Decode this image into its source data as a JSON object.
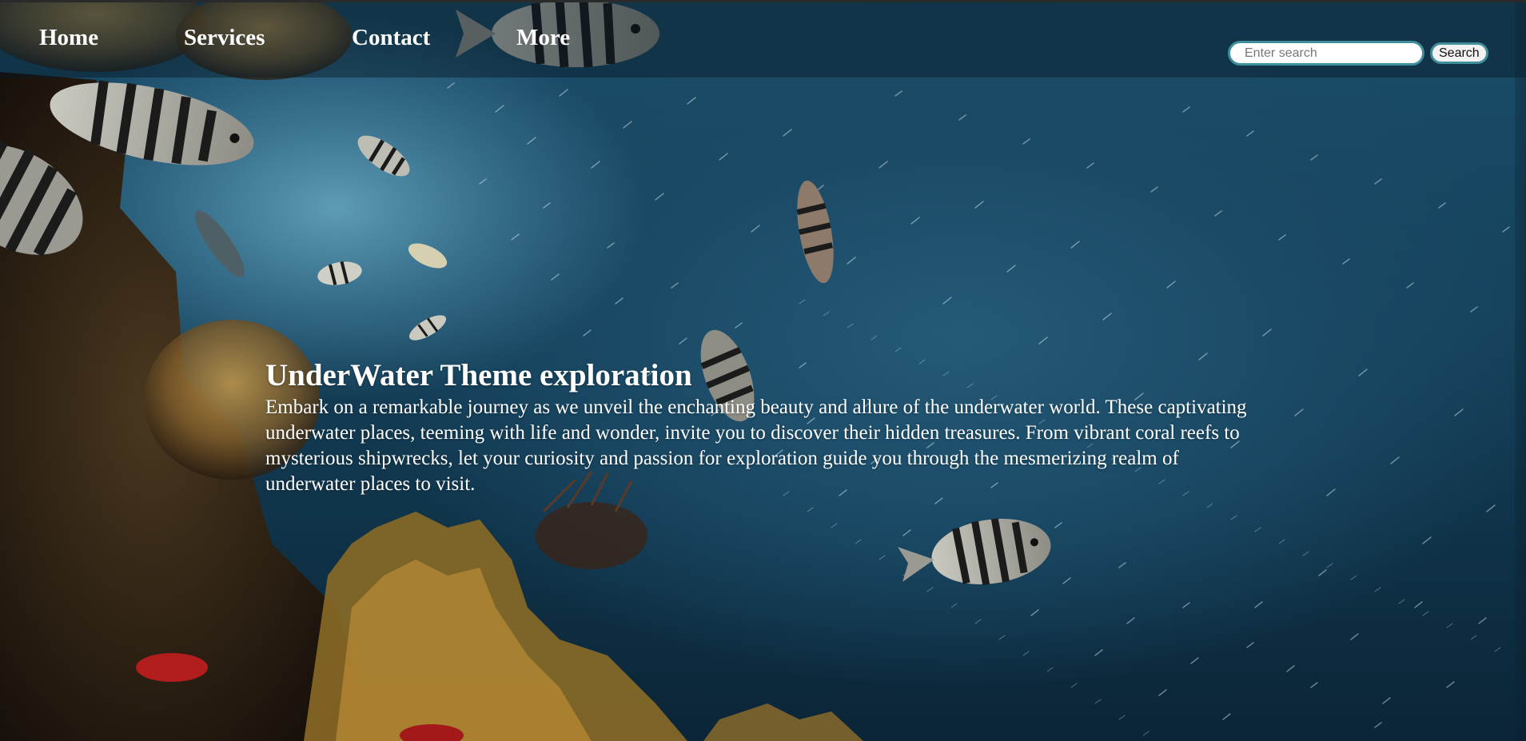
{
  "nav": {
    "items": [
      {
        "label": "Home"
      },
      {
        "label": "Services"
      },
      {
        "label": "Contact"
      },
      {
        "label": "More"
      }
    ]
  },
  "search": {
    "placeholder": "Enter search",
    "value": "",
    "button_label": "Search"
  },
  "hero": {
    "title": "UnderWater Theme exploration",
    "description": "Embark on a remarkable journey as we unveil the enchanting beauty and allure of the underwater world. These captivating underwater places, teeming with life and wonder, invite you to discover their hidden treasures. From vibrant coral reefs to mysterious shipwrecks, let your curiosity and passion for exploration guide you through the mesmerizing realm of underwater places to visit."
  },
  "colors": {
    "accent": "#3e8f9a",
    "nav_text": "#ffffff",
    "hero_text": "#ffffff",
    "water_deep": "#0f3146",
    "water_light": "#5e9bb4"
  },
  "background": {
    "subject": "coral reef with striped fish and a school of small fish"
  }
}
